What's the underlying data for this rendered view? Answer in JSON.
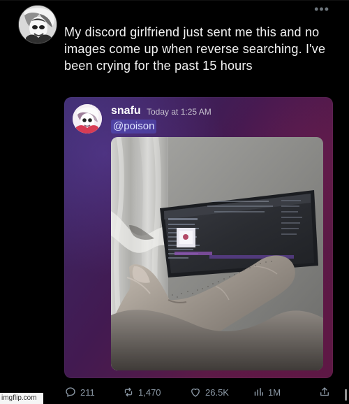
{
  "post": {
    "text": "My discord girlfriend just sent me this and no images come up when reverse searching. I've been crying for the past 15 hours",
    "menu": "•••",
    "avatar_icon": "anime-avatar-icon"
  },
  "embedded_discord": {
    "username": "snafu",
    "timestamp": "Today at 1:25 AM",
    "mention": "@poison",
    "avatar_icon": "anime-avatar-icon",
    "image_icon": "leg-monitor-photo"
  },
  "actions": {
    "reply_count": "211",
    "retweet_count": "1,470",
    "like_count": "26.5K",
    "views_count": "1M"
  },
  "watermark": {
    "label": "imgflip.com"
  },
  "colors": {
    "background": "#000000",
    "text": "#e7e9ea",
    "muted": "#8b98a5",
    "discord_purple": "#421a51",
    "mention_blue": "#5865f2"
  }
}
